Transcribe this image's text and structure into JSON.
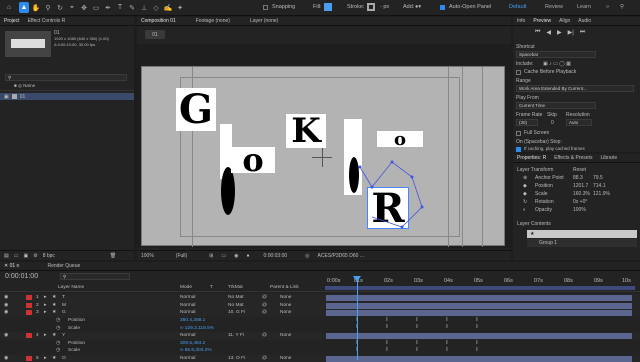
{
  "toolbar": {
    "snapping": "Snapping",
    "fill_label": "Fill:",
    "stroke_label": "Stroke:",
    "stroke_px": "- px",
    "add_label": "Add:",
    "auto_open": "Auto-Open Panel",
    "workspaces": [
      "Default",
      "Review",
      "Learn"
    ],
    "active_workspace": "Default"
  },
  "project": {
    "tabs": [
      "Project",
      "Effect Controls R"
    ],
    "comp_name": "01",
    "comp_info1": "1920 x 1080 (640 x 360) (1.00)",
    "comp_info2": "Δ 0:00:10:00, 30.00 fps",
    "item_name": "01",
    "bpc": "8 bpc"
  },
  "viewer": {
    "tabs": [
      "Composition 01",
      "Footage (none)",
      "Layer (none)"
    ],
    "comp_tab": "01",
    "zoom": "100%",
    "quality": "(Full)",
    "timecode": "0:00:03:00",
    "color": "ACES/P3D65 D60 ...",
    "letters": [
      "G",
      "o",
      "K",
      "o",
      "R"
    ]
  },
  "right_top": {
    "tabs": [
      "Info",
      "Preview",
      "Align",
      "Audio"
    ],
    "shortcut_label": "Shortcut",
    "shortcut_value": "Spacebar",
    "include_label": "Include:",
    "cache_label": "Cache Before Playback",
    "range_label": "Range",
    "range_value": "Work Area Extended By Current...",
    "play_from_label": "Play From",
    "play_from_value": "Current Time",
    "frame_rate_label": "Frame Rate",
    "skip_label": "Skip",
    "resolution_label": "Resolution",
    "frame_rate_value": "(30)",
    "skip_value": "0",
    "resolution_value": "Auto",
    "fullscreen_label": "Full Screen",
    "on_stop_label": "On (Spacebar) Stop:",
    "if_caching": "If caching, play cached frames"
  },
  "properties": {
    "tabs": [
      "Properties: R",
      "Effects & Presets",
      "Librarie"
    ],
    "layer_transform": "Layer Transform",
    "reset": "Reset",
    "anchor_label": "Anchor Point",
    "anchor_x": "88.3",
    "anchor_y": "79.5",
    "position_label": "Position",
    "position_x": "1201.7",
    "position_y": "714.1",
    "scale_label": "Scale",
    "scale_x": "160.3%",
    "scale_y": "121.9%",
    "rotation_label": "Rotation",
    "rotation_value": "0x +0°",
    "opacity_label": "Opacity",
    "opacity_value": "100%",
    "layer_contents": "Layer Contents",
    "group": "Group 1"
  },
  "timeline": {
    "render_queue": "Render Queue",
    "time": "0:00:01:00",
    "columns": {
      "layer_name": "Layer Name",
      "mode": "Mode",
      "t": "T",
      "trkmat": "TrkMat",
      "parent": "Parent & Link"
    },
    "ruler": [
      "0:00s",
      "01s",
      "02s",
      "03s",
      "04s",
      "05s",
      "06s",
      "07s",
      "08s",
      "09s",
      "10s"
    ],
    "rows": [
      {
        "num": "1",
        "name": "T",
        "mode": "Normal",
        "trkmat": "No Mat",
        "parent": "None",
        "type": "layer"
      },
      {
        "num": "2",
        "name": "M",
        "mode": "Normal",
        "trkmat": "No Mat",
        "parent": "None",
        "type": "layer"
      },
      {
        "num": "3",
        "name": "G",
        "mode": "Normal",
        "trkmat": "10. G Fi",
        "parent": "None",
        "type": "layer"
      },
      {
        "num": "",
        "name": "Position",
        "value": "360.4,268.1",
        "type": "prop"
      },
      {
        "num": "",
        "name": "Scale",
        "value": "∞ 129.3,118.5%",
        "type": "prop"
      },
      {
        "num": "4",
        "name": "Y",
        "mode": "Normal",
        "trkmat": "11. Y Fi",
        "parent": "None",
        "type": "layer"
      },
      {
        "num": "",
        "name": "Position",
        "value": "309.5,484.2",
        "type": "prop"
      },
      {
        "num": "",
        "name": "Scale",
        "value": "∞ 66.6,303.2%",
        "type": "prop"
      },
      {
        "num": "5",
        "name": "O",
        "mode": "Normal",
        "trkmat": "13. O Fi",
        "parent": "None",
        "type": "layer"
      }
    ],
    "trkmat_none": "None"
  },
  "colors": {
    "accent": "#2d8ceb",
    "bar": "#5b6690",
    "label_red": "#c33"
  }
}
